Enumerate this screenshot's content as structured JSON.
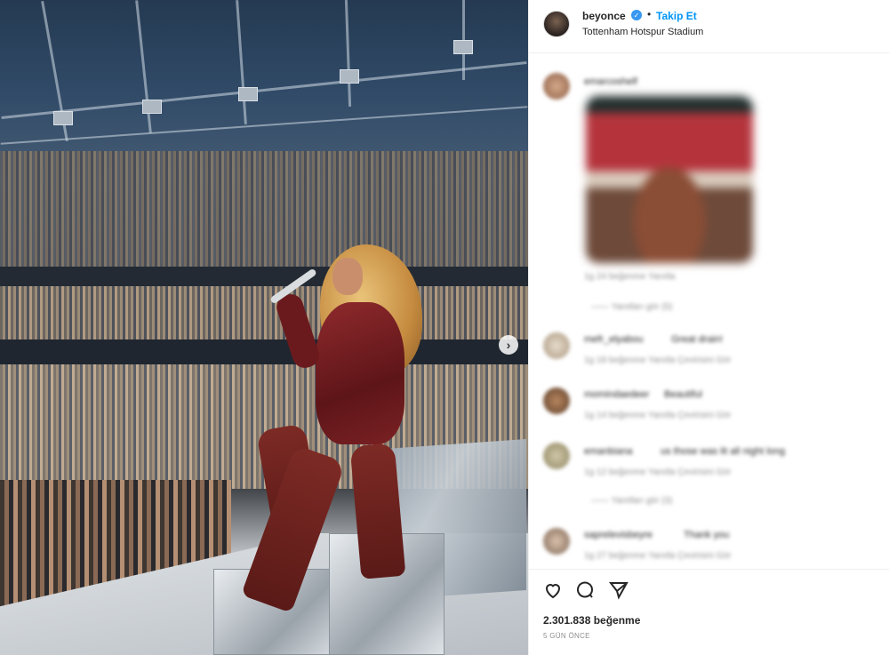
{
  "post": {
    "username": "beyonce",
    "separator": "•",
    "follow_label": "Takip Et",
    "location": "Tottenham Hotspur Stadium",
    "likes": "2.301.838 beğenme",
    "time_ago": "5 GÜN ÖNCE"
  },
  "colors": {
    "link": "#0095f6",
    "verified": "#3897f0",
    "text": "#262626",
    "muted": "#8e8e8e"
  },
  "comments": [
    {
      "user": "emarcoshelf",
      "meta": "1g   24 beğenme   Yanıtla",
      "replies": "—— Yanıtları gör (5)"
    },
    {
      "user": "mefr_elyabou",
      "text": "Great drain!",
      "meta": "1g   18 beğenme   Yanıtla   Çevirisini Gör"
    },
    {
      "user": "momindaedeer",
      "text": "Beautiful",
      "meta": "1g   14 beğenme   Yanıtla   Çevirisini Gör"
    },
    {
      "user": "emanbiana",
      "text": "us those was lit all night long",
      "meta": "1g   12 beğenme   Yanıtla   Çevirisini Gör",
      "replies": "—— Yanıtları gör (3)"
    },
    {
      "user": "saprelevisbeyre",
      "text": "Thank you",
      "meta": "1g   27 beğenme   Yanıtla   Çevirisini Gör"
    }
  ],
  "icons": {
    "verified": "verified-badge-icon",
    "next": "chevron-right-icon",
    "like": "heart-icon",
    "comment": "comment-bubble-icon",
    "share": "paper-plane-icon"
  },
  "glyphs": {
    "next": "›",
    "verified_check": "✓"
  }
}
